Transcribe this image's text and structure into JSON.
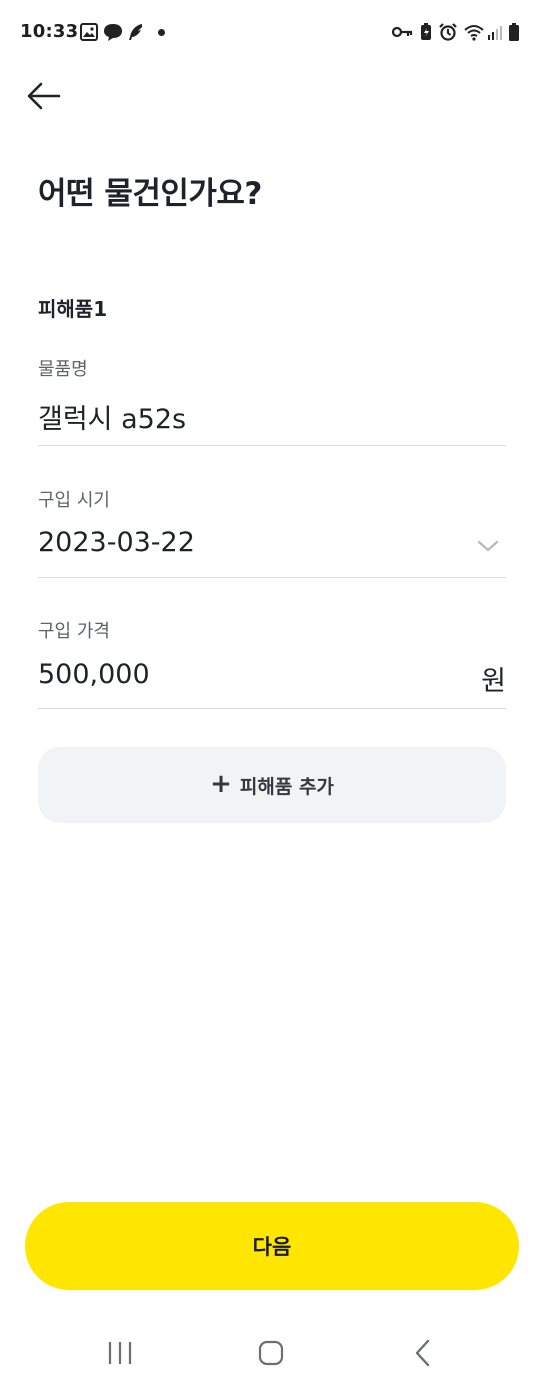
{
  "status_bar": {
    "time": "10:33",
    "left_icons": [
      "image-icon",
      "chat-bubble-icon",
      "feather-icon",
      "notification-dot"
    ],
    "right_icons": [
      "key-icon",
      "battery-saver-icon",
      "alarm-icon",
      "wifi-icon",
      "signal-icon",
      "battery-icon"
    ]
  },
  "header": {
    "back_icon": "arrow-left-icon",
    "title": "어떤 물건인가요?"
  },
  "item": {
    "section_title": "피해품1",
    "name": {
      "label": "물품명",
      "value": "갤럭시 a52s"
    },
    "purchase_date": {
      "label": "구입 시기",
      "value": "2023-03-22",
      "icon": "chevron-down-icon"
    },
    "purchase_price": {
      "label": "구입 가격",
      "value": "500,000",
      "unit": "원"
    }
  },
  "add_item_button": {
    "icon": "+",
    "label": "피해품 추가"
  },
  "next_button": {
    "label": "다음"
  },
  "colors": {
    "accent": "#ffe600",
    "text": "#1f2228",
    "muted": "#5f6369",
    "divider": "#d9dadc",
    "secondary_bg": "#f2f3f5"
  },
  "nav_bar": {
    "items": [
      "recent-apps-icon",
      "home-icon",
      "back-icon"
    ]
  }
}
